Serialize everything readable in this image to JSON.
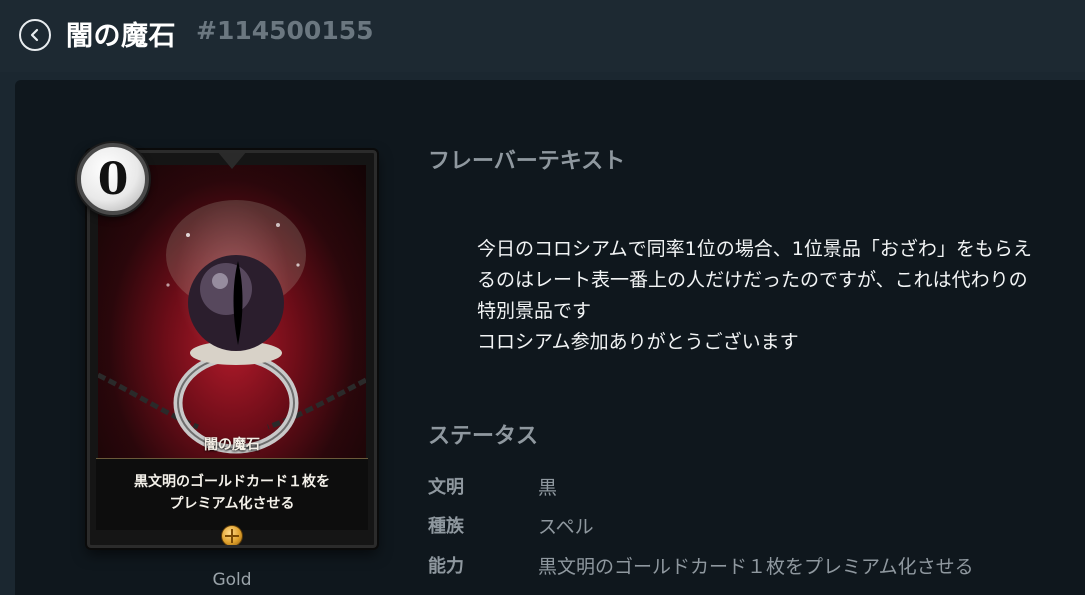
{
  "header": {
    "title": "闇の魔石",
    "card_id": "#114500155"
  },
  "card": {
    "cost": "0",
    "name": "闇の魔石",
    "text_line1": "黒文明のゴールドカード１枚を",
    "text_line2": "プレミアム化させる",
    "rarity": "Gold",
    "rarity_color": "#e0a12c"
  },
  "flavor": {
    "heading": "フレーバーテキスト",
    "text": "今日のコロシアムで同率1位の場合、1位景品「おざわ」をもらえ\nるのはレート表一番上の人だけだったのですが、これは代わりの\n特別景品です\nコロシアム参加ありがとうございます"
  },
  "status": {
    "heading": "ステータス",
    "rows": [
      {
        "key": "文明",
        "value": "黒"
      },
      {
        "key": "種族",
        "value": "スペル"
      },
      {
        "key": "能力",
        "value": "黒文明のゴールドカード１枚をプレミアム化させる"
      }
    ]
  },
  "colors": {
    "background": "#1b2730",
    "panel": "#0f171d",
    "muted_text": "#8f989f"
  }
}
